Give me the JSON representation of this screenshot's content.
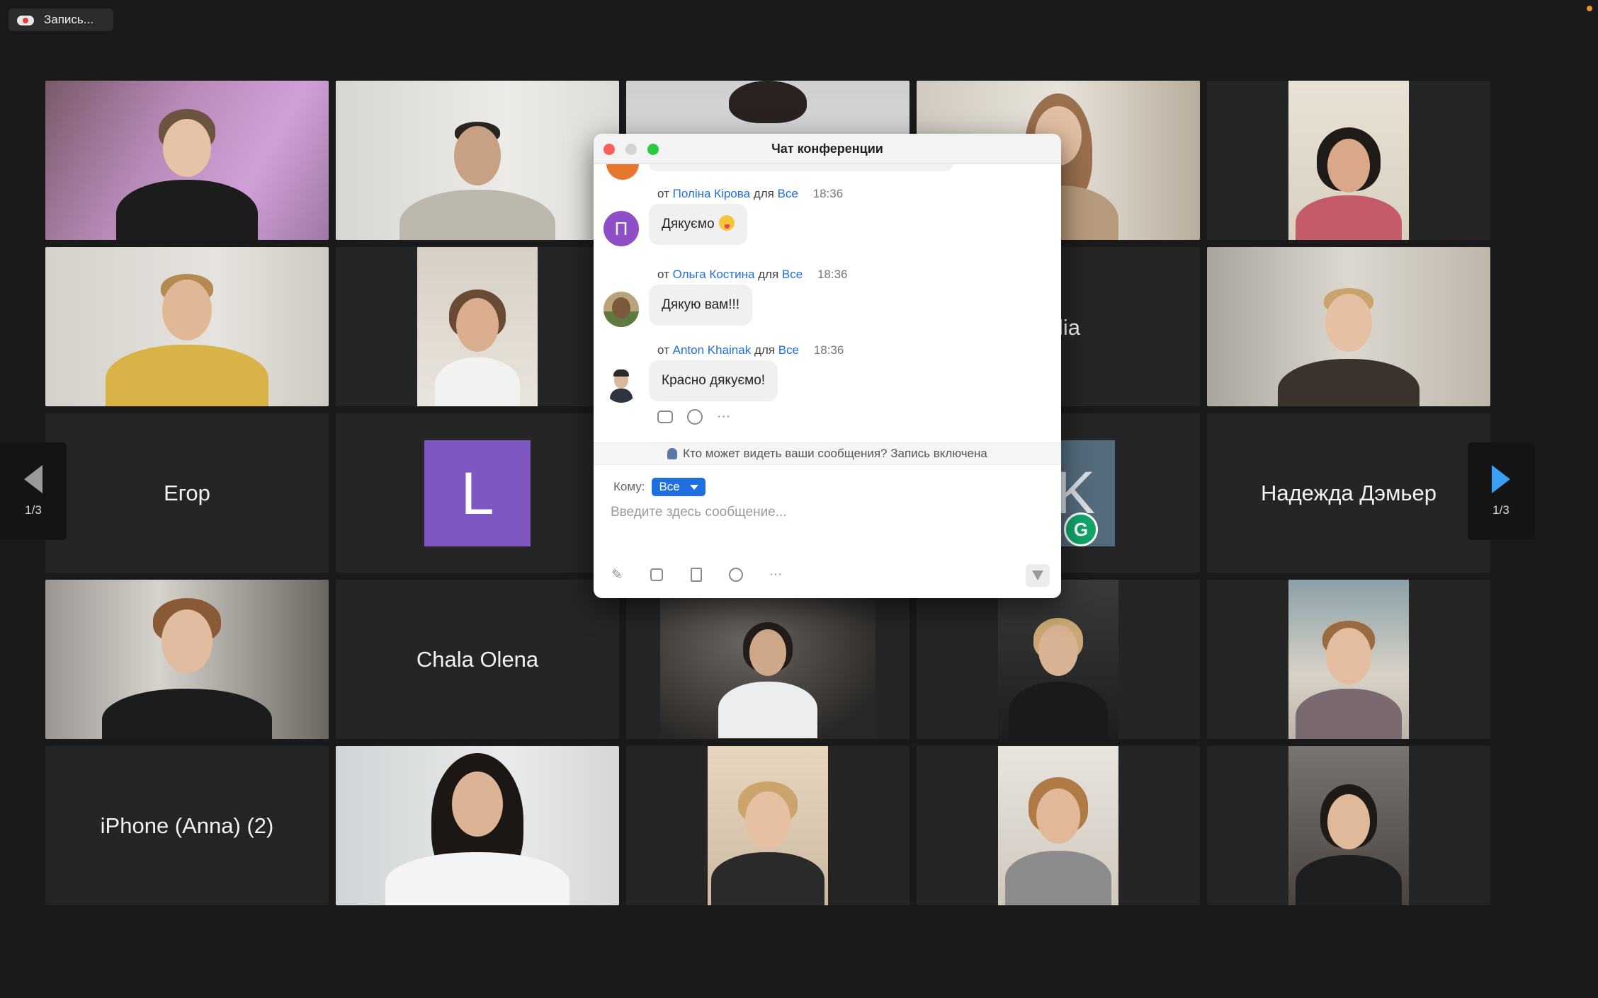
{
  "recording": {
    "label": "Запись..."
  },
  "gallery": {
    "names": {
      "egor": "Егор",
      "avatar_l": "L",
      "partial_name": "lia",
      "avatar_k": "K",
      "nadezhda": "Надежда Дэмьер",
      "chala": "Chala Olena",
      "iphone_anna": "iPhone (Anna) (2)"
    },
    "pager_left": "1/3",
    "pager_right": "1/3",
    "active_border_color": "#3fd24a"
  },
  "chat": {
    "title": "Чат конференции",
    "messages": [
      {
        "prefix": "от",
        "sender": "Поліна Кірова",
        "to_word": "для",
        "recipient": "Все",
        "time": "18:36",
        "text": "Дякуємо",
        "avatar_letter": "П"
      },
      {
        "prefix": "от",
        "sender": "Ольга Костина",
        "to_word": "для",
        "recipient": "Все",
        "time": "18:36",
        "text": "Дякую вам!!!"
      },
      {
        "prefix": "от",
        "sender": "Anton Khainak",
        "to_word": "для",
        "recipient": "Все",
        "time": "18:36",
        "text": "Красно дякуємо!"
      }
    ],
    "privacy_note": "Кто может видеть ваши сообщения? Запись включена",
    "to_label": "Кому:",
    "to_value": "Все",
    "input_placeholder": "Введите здесь сообщение...",
    "more_glyph": "···",
    "icons": [
      "reply-icon",
      "add-reaction-icon",
      "more-icon",
      "format-icon",
      "screenshot-icon",
      "file-icon",
      "emoji-icon",
      "send-icon"
    ]
  }
}
